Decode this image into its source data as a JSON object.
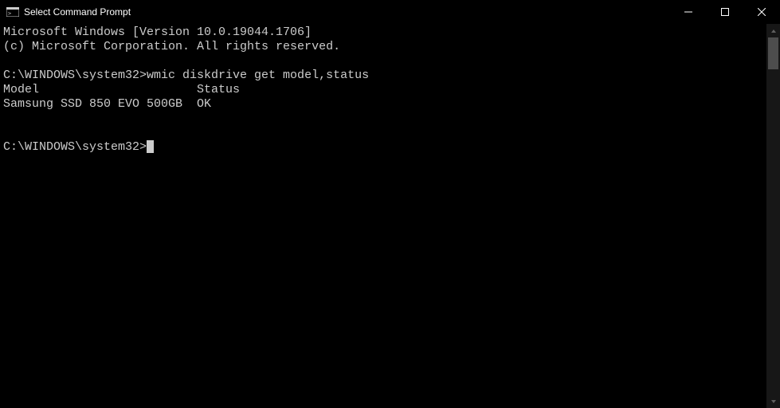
{
  "titlebar": {
    "title": "Select Command Prompt"
  },
  "terminal": {
    "banner_line1": "Microsoft Windows [Version 10.0.19044.1706]",
    "banner_line2": "(c) Microsoft Corporation. All rights reserved.",
    "blank1": "",
    "prompt1": "C:\\WINDOWS\\system32>",
    "command1": "wmic diskdrive get model,status",
    "output_header": "Model                      Status",
    "output_row1": "Samsung SSD 850 EVO 500GB  OK",
    "blank2": "",
    "blank3": "",
    "prompt2": "C:\\WINDOWS\\system32>"
  }
}
